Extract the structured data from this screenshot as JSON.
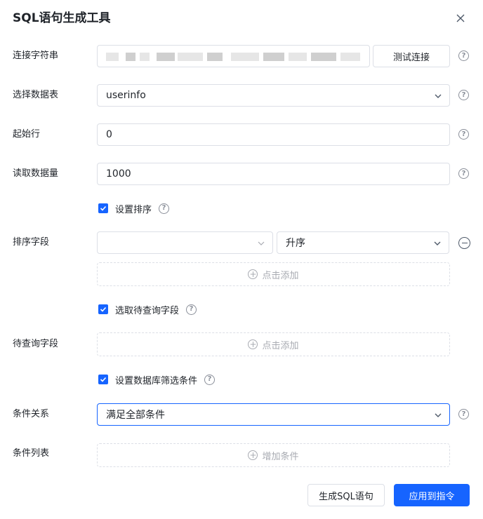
{
  "dialog": {
    "title": "SQL语句生成工具"
  },
  "connection": {
    "label": "连接字符串",
    "test_button": "测试连接"
  },
  "table": {
    "label": "选择数据表",
    "value": "userinfo"
  },
  "start_row": {
    "label": "起始行",
    "value": "0"
  },
  "read_count": {
    "label": "读取数据量",
    "value": "1000"
  },
  "sort": {
    "toggle_label": "设置排序",
    "checked": true,
    "field_label": "排序字段",
    "field_value": "",
    "order_value": "升序",
    "add_label": "点击添加"
  },
  "query_fields": {
    "toggle_label": "选取待查询字段",
    "checked": true,
    "label": "待查询字段",
    "add_label": "点击添加"
  },
  "filter": {
    "toggle_label": "设置数据库筛选条件",
    "checked": true,
    "relation_label": "条件关系",
    "relation_value": "满足全部条件",
    "list_label": "条件列表",
    "add_label": "增加条件"
  },
  "footer": {
    "generate_button": "生成SQL语句",
    "apply_button": "应用到指令"
  },
  "colors": {
    "primary": "#1664ff",
    "border": "#dcdfe6",
    "muted": "#a8abb2"
  }
}
